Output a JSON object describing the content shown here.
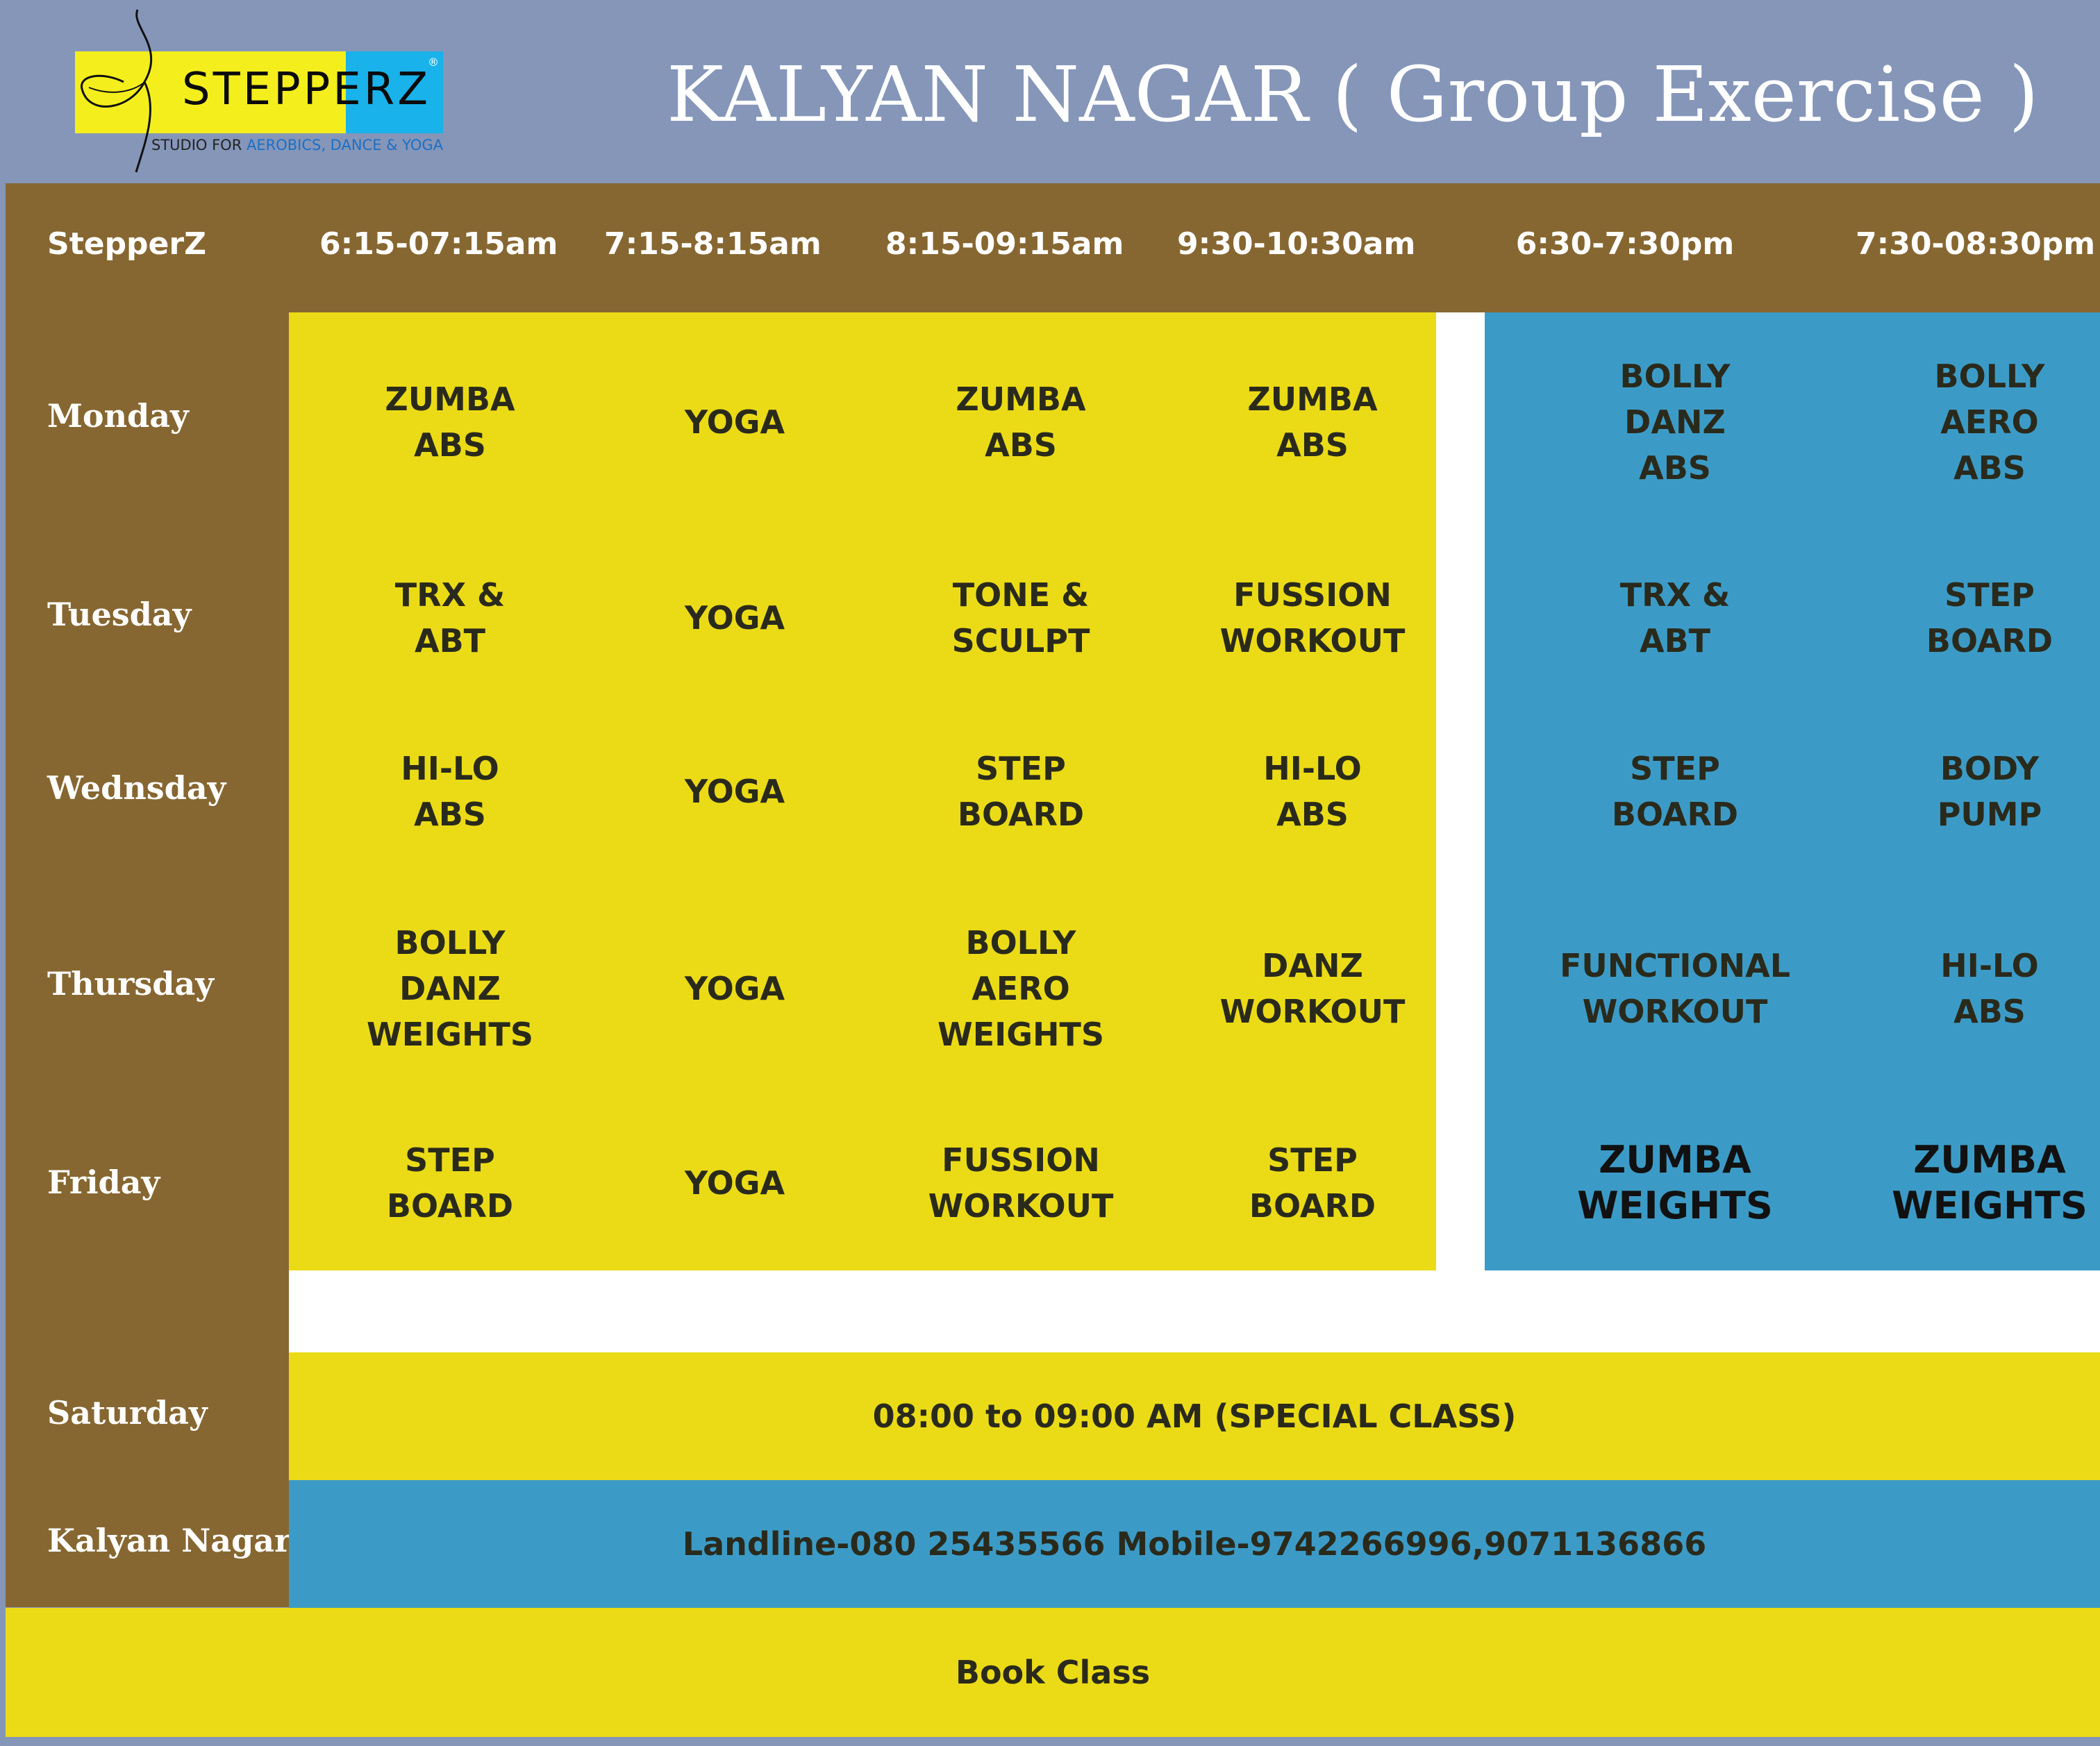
{
  "brand": {
    "logo_name": "STEPPERZ",
    "tagline_prefix": "STUDIO  FOR ",
    "tagline_highlight": "AEROBICS, DANCE & YOGA",
    "registered_mark": "®"
  },
  "page_title": "KALYAN NAGAR ( Group Exercise )",
  "table": {
    "corner_label": "StepperZ",
    "time_slots": [
      "6:15-07:15am",
      "7:15-8:15am",
      "8:15-09:15am",
      "9:30-10:30am",
      "6:30-7:30pm",
      "7:30-08:30pm"
    ],
    "days": [
      {
        "day": "Monday",
        "classes": [
          "ZUMBA\nABS",
          "YOGA",
          "ZUMBA\nABS",
          "ZUMBA\nABS",
          "BOLLY\nDANZ\nABS",
          "BOLLY\nAERO\nABS"
        ]
      },
      {
        "day": "Tuesday",
        "classes": [
          "TRX &\nABT",
          "YOGA",
          "TONE &\nSCULPT",
          "FUSSION\nWORKOUT",
          "TRX &\nABT",
          "STEP\nBOARD"
        ]
      },
      {
        "day": "Wednsday",
        "classes": [
          "HI-LO\nABS",
          "YOGA",
          "STEP\nBOARD",
          "HI-LO\nABS",
          "STEP\nBOARD",
          "BODY\nPUMP"
        ]
      },
      {
        "day": "Thursday",
        "classes": [
          "BOLLY\nDANZ\nWEIGHTS",
          "YOGA",
          "BOLLY\nAERO\nWEIGHTS",
          "DANZ\nWORKOUT",
          "FUNCTIONAL\nWORKOUT",
          "HI-LO\nABS"
        ]
      },
      {
        "day": "Friday",
        "classes": [
          "STEP\nBOARD",
          "YOGA",
          "FUSSION\nWORKOUT",
          "STEP\nBOARD",
          "ZUMBA\nWEIGHTS",
          "ZUMBA\nWEIGHTS"
        ]
      }
    ],
    "saturday": {
      "label": "Saturday",
      "text": "08:00 to 09:00 AM (SPECIAL CLASS)"
    },
    "contact": {
      "label": "Kalyan Nagar",
      "text": "Landline-080 25435566 Mobile-9742266996,9071136866"
    },
    "book_label": "Book Class"
  },
  "colors": {
    "header_bg": "#8596b9",
    "table_brown": "#876731",
    "morning_yellow": "#ebdb16",
    "evening_blue": "#3c9bc6"
  }
}
